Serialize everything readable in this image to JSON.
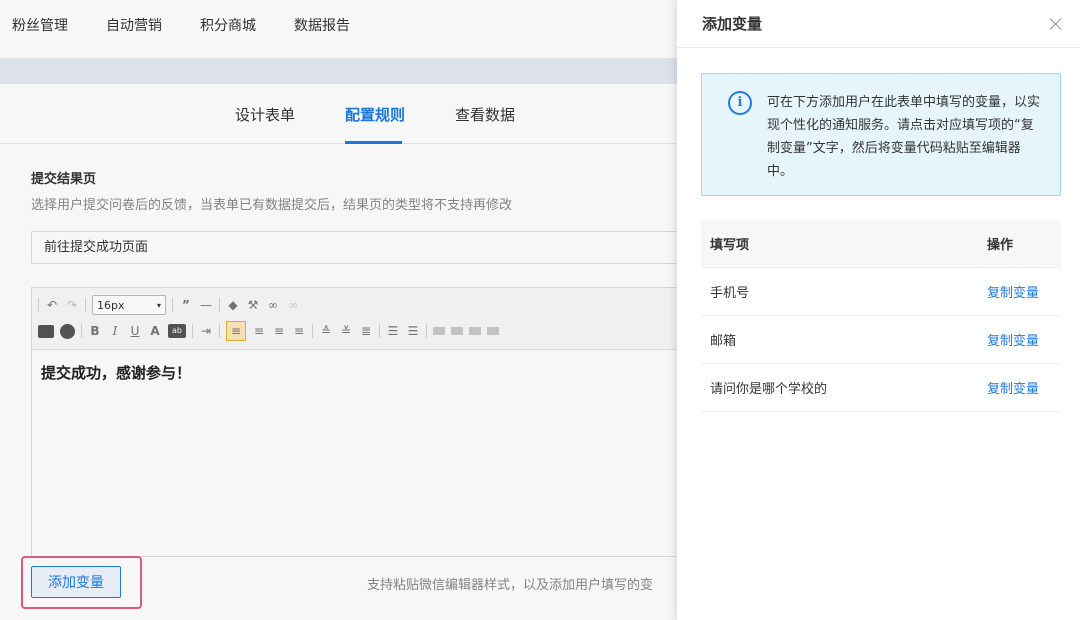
{
  "topnav": {
    "items": [
      "粉丝管理",
      "自动营销",
      "积分商城",
      "数据报告"
    ]
  },
  "subtabs": {
    "items": [
      "设计表单",
      "配置规则",
      "查看数据"
    ],
    "active_index": 1
  },
  "result_section": {
    "title": "提交结果页",
    "description": "选择用户提交问卷后的反馈，当表单已有数据提交后，结果页的类型将不支持再修改",
    "selected_option": "前往提交成功页面"
  },
  "editor": {
    "font_size": "16px",
    "content": "提交成功，感谢参与！",
    "bold_label": "B",
    "italic_label": "I",
    "underline_label": "U",
    "font_color_label": "A",
    "bg_color_label": "ab"
  },
  "footer": {
    "add_variable_label": "添加变量",
    "paste_hint": "支持粘贴微信编辑器样式，以及添加用户填写的变"
  },
  "drawer": {
    "title": "添加变量",
    "info_text": "可在下方添加用户在此表单中填写的变量，以实现个性化的通知服务。请点击对应填写项的“复制变量”文字，然后将变量代码粘贴至编辑器中。",
    "table": {
      "headers": {
        "field": "填写项",
        "action": "操作"
      },
      "rows": [
        {
          "field": "手机号",
          "action": "复制变量"
        },
        {
          "field": "邮箱",
          "action": "复制变量"
        },
        {
          "field": "请问你是哪个学校的",
          "action": "复制变量"
        }
      ]
    }
  },
  "colors": {
    "accent": "#1e7be0",
    "highlight_frame": "#e0607e",
    "info_bg": "#e6f4fb"
  }
}
